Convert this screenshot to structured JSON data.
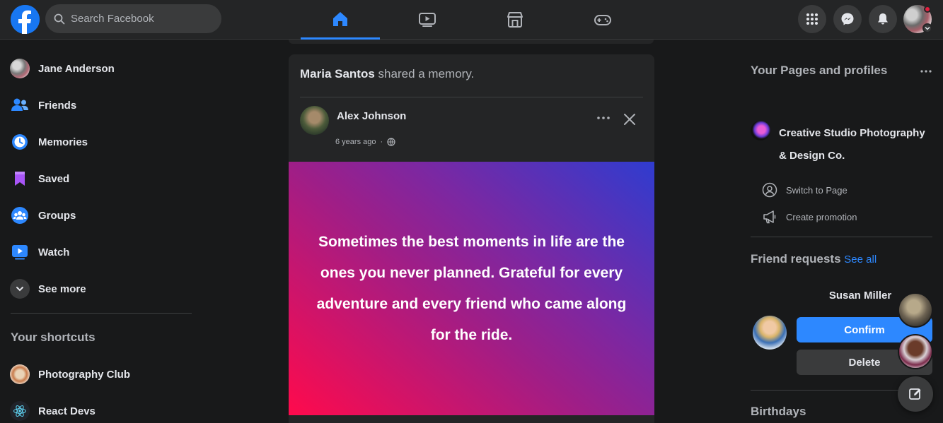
{
  "topbar": {
    "search_placeholder": "Search Facebook",
    "nav_tabs": [
      "home",
      "watch",
      "marketplace",
      "gaming"
    ],
    "active_tab": "home",
    "icons": [
      "facebook-logo-icon",
      "search-icon",
      "menu-grid-icon",
      "messenger-icon",
      "bell-icon",
      "chevron-down-icon"
    ],
    "accent": "#2d88ff",
    "notification_dot_color": "#e41e3f"
  },
  "sidebar": {
    "items": [
      {
        "label": "Jane Anderson",
        "icon": "avatar"
      },
      {
        "label": "Friends",
        "icon": "friends-icon"
      },
      {
        "label": "Memories",
        "icon": "clock-icon"
      },
      {
        "label": "Saved",
        "icon": "bookmark-icon"
      },
      {
        "label": "Groups",
        "icon": "groups-icon"
      },
      {
        "label": "Watch",
        "icon": "watch-icon"
      },
      {
        "label": "See more",
        "icon": "chevron-down-icon"
      }
    ],
    "shortcuts_title": "Your shortcuts",
    "shortcuts": [
      {
        "label": "Photography Club"
      },
      {
        "label": "React Devs"
      }
    ]
  },
  "feed": {
    "header_name": "Maria Santos",
    "header_rest": "shared a memory.",
    "author": "Alex Johnson",
    "timestamp": "6 years ago",
    "body": "Sometimes the best moments in life are the ones you never planned. Grateful for every adventure and every friend who came along for the ride."
  },
  "right": {
    "pages_title": "Your Pages and profiles",
    "page_name": "Creative Studio Photography & Design Co.",
    "links": [
      {
        "label": "Switch to Page",
        "icon": "switch-profile-icon"
      },
      {
        "label": "Create promotion",
        "icon": "megaphone-icon"
      }
    ],
    "friend_requests_title": "Friend requests",
    "see_all": "See all",
    "request_name": "Susan Miller",
    "confirm_label": "Confirm",
    "delete_label": "Delete",
    "birthdays_title": "Birthdays"
  },
  "chat": {
    "icons": [
      "compose-icon"
    ]
  }
}
